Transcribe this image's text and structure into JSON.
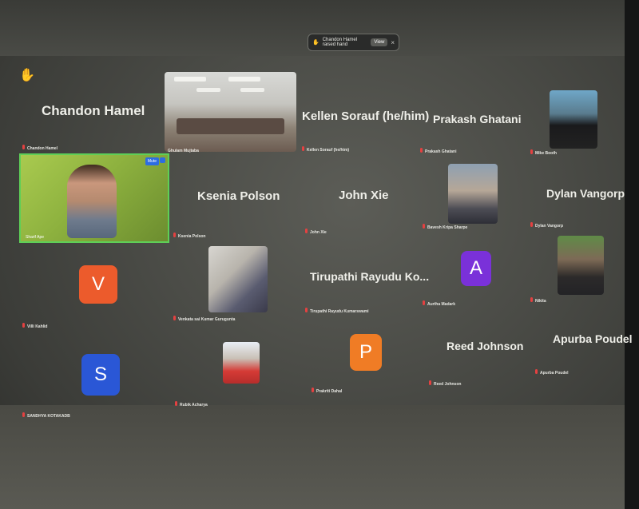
{
  "banner": {
    "text": "Chandon Hamel raised hand",
    "view_label": "View",
    "close_label": "×"
  },
  "tiles": [
    {
      "name": "Chandon Hamel",
      "footer": "Chandon Hamel"
    },
    {
      "name": "",
      "footer": "Ghulam Mujtaba"
    },
    {
      "name": "Kellen Sorauf (he/him)",
      "footer": "Kellen Sorauf (he/him)"
    },
    {
      "name": "Prakash Ghatani",
      "footer": "Prakash Ghatani"
    },
    {
      "name": "",
      "footer": "Mike Booth"
    },
    {
      "name": "",
      "footer": "Sharif Ape"
    },
    {
      "name": "Ksenia Polson",
      "footer": "Ksenia Polson"
    },
    {
      "name": "John Xie",
      "footer": "John Xie"
    },
    {
      "name": "",
      "footer": "Bavesh Kripa Sharpe"
    },
    {
      "name": "Dylan Vangorp",
      "footer": "Dylan Vangorp"
    },
    {
      "name": "",
      "avatar": "V",
      "footer": "Villi Kahlid"
    },
    {
      "name": "",
      "footer": "Venkata sai Kumar Gurugunta"
    },
    {
      "name": "Tirupathi Rayudu Ko...",
      "footer": "Tirupathi Rayudu Kumarswami"
    },
    {
      "name": "",
      "avatar": "A",
      "footer": "Aurtha Madark"
    },
    {
      "name": "",
      "footer": "Nikita"
    },
    {
      "name": "",
      "avatar": "S",
      "footer": "SANDHYA KOTAKADB"
    },
    {
      "name": "",
      "footer": "Rubik Acharya"
    },
    {
      "name": "",
      "avatar": "P",
      "footer": "Prakriti Dahal"
    },
    {
      "name": "Reed Johnson",
      "footer": "Reed Johnson"
    },
    {
      "name": "Apurba Poudel",
      "footer": "Apurba Poudel"
    }
  ],
  "video_buttons": {
    "mute_label": "Mute"
  },
  "colors": {
    "avatar_v": "#ec5b2c",
    "avatar_a": "#7a31d9",
    "avatar_s": "#2a57d6",
    "avatar_p": "#f07c25",
    "active_border": "#5ecf57"
  },
  "icons": {
    "raised_hand": "✋"
  }
}
